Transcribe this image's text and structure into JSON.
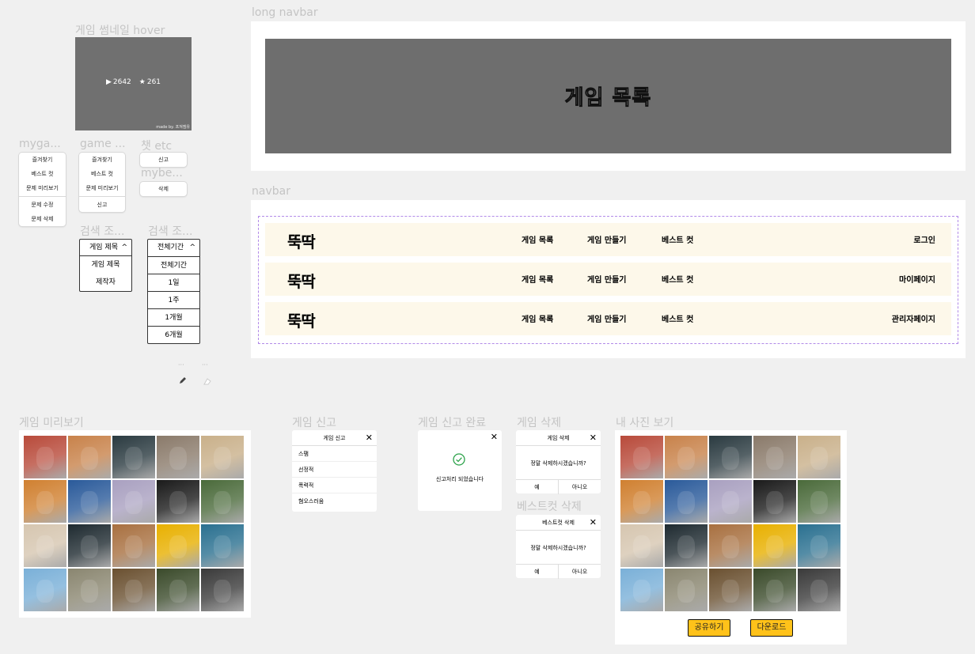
{
  "frames": {
    "thumb_hover": "게임 썸네일 hover",
    "mygame": "myga...",
    "game_menu": "game ...",
    "chat_etc": "챗 etc",
    "mybest": "mybe...",
    "search1": "검색 조...",
    "search2": "검색 조...",
    "long_navbar": "long navbar",
    "navbar": "navbar",
    "game_preview": "게임 미리보기",
    "game_report": "게임 신고",
    "report_done": "게임 신고 완료",
    "game_delete": "게임 삭제",
    "best_delete": "베스트컷 삭제",
    "my_photos": "내 사진 보기"
  },
  "thumbnail": {
    "plays": "2642",
    "stars": "261",
    "made_by": "made by. 프져엠유"
  },
  "mygame_menu": [
    "즐겨찾기",
    "베스트 컷",
    "문제 미리보기",
    "문제 수정",
    "문제 삭제"
  ],
  "game_menu": [
    "즐겨찾기",
    "베스트 컷",
    "문제 미리보기",
    "신고"
  ],
  "chat_menu": [
    "신고"
  ],
  "mybest_menu": [
    "삭제"
  ],
  "search_type": {
    "selected": "게임 제목",
    "options": [
      "게임 제목",
      "제작자"
    ]
  },
  "search_period": {
    "selected": "전체기간",
    "options": [
      "전체기간",
      "1일",
      "1주",
      "1개월",
      "6개월"
    ]
  },
  "misc_icons": {
    "dots1": "···",
    "dots2": "···"
  },
  "long_navbar_title": "게임 목록",
  "navbar": {
    "logo": "뚝딱",
    "links": [
      "게임 목록",
      "게임 만들기",
      "베스트 컷"
    ],
    "right": [
      "로그인",
      "마이페이지",
      "관리자페이지"
    ]
  },
  "report_modal": {
    "title": "게임 신고",
    "reasons": [
      "스팸",
      "선정적",
      "폭력적",
      "혐오스러움"
    ]
  },
  "report_done_text": "신고처리 되었습니다",
  "delete_modal": {
    "title": "게임 삭제",
    "question": "정말 삭제하시겠습니까?",
    "yes": "예",
    "no": "아니오"
  },
  "best_delete_modal": {
    "title": "베스트컷 삭제",
    "question": "정말 삭제하시겠습니까?",
    "yes": "예",
    "no": "아니오"
  },
  "photo_actions": {
    "share": "공유하기",
    "download": "다운로드"
  },
  "tile_colors": [
    "#b84a3a",
    "#c8824a",
    "#2a3a40",
    "#8a7a6a",
    "#c9b08a",
    "#d08030",
    "#2a5a9a",
    "#a9a0c0",
    "#1a1a1a",
    "#4a6a3a",
    "#d6c6b0",
    "#1e2a30",
    "#a87040",
    "#e8b000",
    "#2a7090",
    "#7ab0d8",
    "#8a8670",
    "#6a5030",
    "#3a4a2a",
    "#3a3a3a"
  ]
}
